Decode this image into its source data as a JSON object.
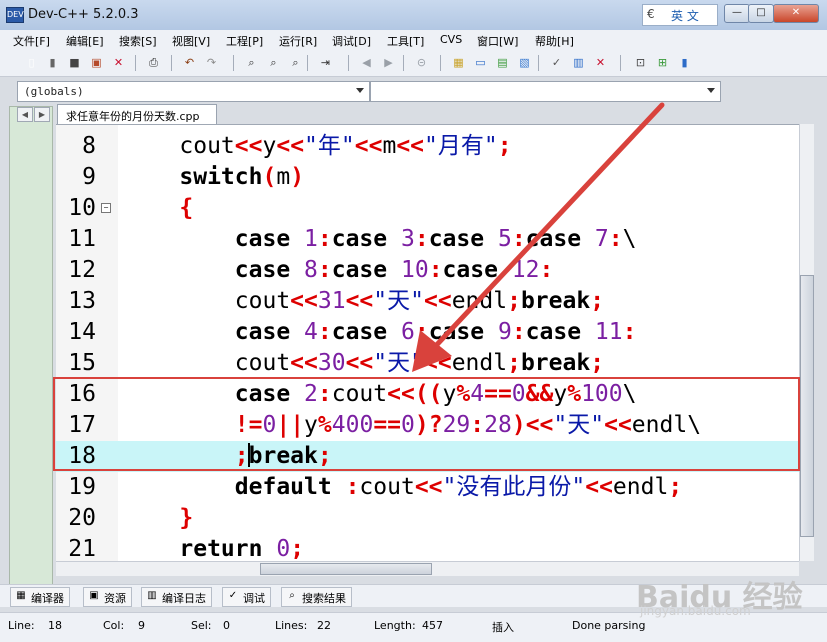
{
  "window": {
    "title": "Dev-C++ 5.2.0.3",
    "app_icon": "DEV"
  },
  "ime": {
    "label": "英 文",
    "logo_glyph": "€",
    "logo_icon": "ime-logo-icon"
  },
  "window_buttons": {
    "minimize": "—",
    "restore": "□",
    "close": "✕"
  },
  "menu": [
    "文件[F]",
    "编辑[E]",
    "搜索[S]",
    "视图[V]",
    "工程[P]",
    "运行[R]",
    "调试[D]",
    "工具[T]",
    "CVS",
    "窗口[W]",
    "帮助[H]"
  ],
  "toolbar_icons": [
    {
      "name": "new-file-icon",
      "glyph": "▯",
      "color": "#ffffff"
    },
    {
      "name": "open-file-icon",
      "glyph": "▮",
      "color": "#666666"
    },
    {
      "name": "save-icon",
      "glyph": "■",
      "color": "#444444"
    },
    {
      "name": "save-all-icon",
      "glyph": "▣",
      "color": "#b54a2a"
    },
    {
      "name": "close-file-icon",
      "glyph": "✕",
      "color": "#c8102e"
    },
    {
      "name": "print-icon",
      "glyph": "⎙",
      "color": "#333333"
    },
    {
      "name": "undo-icon",
      "glyph": "↶",
      "color": "#8a3d12"
    },
    {
      "name": "redo-icon",
      "glyph": "↷",
      "color": "#8a8a8a"
    },
    {
      "name": "find-icon",
      "glyph": "⌕",
      "color": "#333333"
    },
    {
      "name": "find-next-icon",
      "glyph": "⌕",
      "color": "#333333"
    },
    {
      "name": "replace-icon",
      "glyph": "⌕",
      "color": "#333333"
    },
    {
      "name": "goto-line-icon",
      "glyph": "⇥",
      "color": "#333333"
    },
    {
      "name": "bookmark-prev-icon",
      "glyph": "◀",
      "color": "#9aa0a8"
    },
    {
      "name": "bookmark-next-icon",
      "glyph": "▶",
      "color": "#9aa0a8"
    },
    {
      "name": "stop-icon",
      "glyph": "⊝",
      "color": "#9aa0a8"
    },
    {
      "name": "compile-icon",
      "glyph": "▦",
      "color": "#c9a227"
    },
    {
      "name": "run-icon",
      "glyph": "▭",
      "color": "#2d6cc8"
    },
    {
      "name": "compile-run-icon",
      "glyph": "▤",
      "color": "#3a9a3a"
    },
    {
      "name": "rebuild-icon",
      "glyph": "▧",
      "color": "#3b7bd0"
    },
    {
      "name": "check-syntax-icon",
      "glyph": "✓",
      "color": "#555555"
    },
    {
      "name": "profile-icon",
      "glyph": "▥",
      "color": "#2d6cc8"
    },
    {
      "name": "delete-profile-icon",
      "glyph": "✕",
      "color": "#c8102e"
    },
    {
      "name": "new-project-icon",
      "glyph": "⊡",
      "color": "#444444"
    },
    {
      "name": "add-to-project-icon",
      "glyph": "⊞",
      "color": "#3a9a3a"
    },
    {
      "name": "project-options-icon",
      "glyph": "▮",
      "color": "#2d6cc8"
    }
  ],
  "scope_combo": {
    "value": "(globals)"
  },
  "member_combo": {
    "value": ""
  },
  "tab_nav": {
    "left": "◀",
    "right": "▶"
  },
  "file_tab": {
    "label": "求任意年份的月份天数.cpp"
  },
  "code_lines": [
    {
      "num": "8",
      "tokens": [
        [
          "t",
          "    cout"
        ],
        [
          "o",
          "<<"
        ],
        [
          "t",
          "y"
        ],
        [
          "o",
          "<<"
        ],
        [
          "s",
          "\"年\""
        ],
        [
          "o",
          "<<"
        ],
        [
          "t",
          "m"
        ],
        [
          "o",
          "<<"
        ],
        [
          "s",
          "\"月有\""
        ],
        [
          "o",
          ";"
        ]
      ]
    },
    {
      "num": "9",
      "tokens": [
        [
          "k",
          "    switch"
        ],
        [
          "o",
          "("
        ],
        [
          "t",
          "m"
        ],
        [
          "o",
          ")"
        ]
      ]
    },
    {
      "num": "10",
      "fold": "−",
      "tokens": [
        [
          "o",
          "    {"
        ]
      ]
    },
    {
      "num": "11",
      "tokens": [
        [
          "k",
          "        case "
        ],
        [
          "n",
          "1"
        ],
        [
          "o",
          ":"
        ],
        [
          "k",
          "case "
        ],
        [
          "n",
          "3"
        ],
        [
          "o",
          ":"
        ],
        [
          "k",
          "case "
        ],
        [
          "n",
          "5"
        ],
        [
          "o",
          ":"
        ],
        [
          "k",
          "case "
        ],
        [
          "n",
          "7"
        ],
        [
          "o",
          ":"
        ],
        [
          "t",
          "\\"
        ]
      ]
    },
    {
      "num": "12",
      "tokens": [
        [
          "k",
          "        case "
        ],
        [
          "n",
          "8"
        ],
        [
          "o",
          ":"
        ],
        [
          "k",
          "case "
        ],
        [
          "n",
          "10"
        ],
        [
          "o",
          ":"
        ],
        [
          "k",
          "case "
        ],
        [
          "n",
          "12"
        ],
        [
          "o",
          ":"
        ]
      ]
    },
    {
      "num": "13",
      "tokens": [
        [
          "t",
          "        cout"
        ],
        [
          "o",
          "<<"
        ],
        [
          "n",
          "31"
        ],
        [
          "o",
          "<<"
        ],
        [
          "s",
          "\"天\""
        ],
        [
          "o",
          "<<"
        ],
        [
          "t",
          "endl"
        ],
        [
          "o",
          ";"
        ],
        [
          "k",
          "break"
        ],
        [
          "o",
          ";"
        ]
      ]
    },
    {
      "num": "14",
      "tokens": [
        [
          "k",
          "        case "
        ],
        [
          "n",
          "4"
        ],
        [
          "o",
          ":"
        ],
        [
          "k",
          "case "
        ],
        [
          "n",
          "6"
        ],
        [
          "o",
          ":"
        ],
        [
          "k",
          "case "
        ],
        [
          "n",
          "9"
        ],
        [
          "o",
          ":"
        ],
        [
          "k",
          "case "
        ],
        [
          "n",
          "11"
        ],
        [
          "o",
          ":"
        ]
      ]
    },
    {
      "num": "15",
      "tokens": [
        [
          "t",
          "        cout"
        ],
        [
          "o",
          "<<"
        ],
        [
          "n",
          "30"
        ],
        [
          "o",
          "<<"
        ],
        [
          "s",
          "\"天\""
        ],
        [
          "o",
          "<<"
        ],
        [
          "t",
          "endl"
        ],
        [
          "o",
          ";"
        ],
        [
          "k",
          "break"
        ],
        [
          "o",
          ";"
        ]
      ]
    },
    {
      "num": "16",
      "tokens": [
        [
          "k",
          "        case "
        ],
        [
          "n",
          "2"
        ],
        [
          "o",
          ":"
        ],
        [
          "t",
          "cout"
        ],
        [
          "o",
          "<<(("
        ],
        [
          "t",
          "y"
        ],
        [
          "o",
          "%"
        ],
        [
          "n",
          "4"
        ],
        [
          "o",
          "=="
        ],
        [
          "n",
          "0"
        ],
        [
          "o",
          "&&"
        ],
        [
          "t",
          "y"
        ],
        [
          "o",
          "%"
        ],
        [
          "n",
          "100"
        ],
        [
          "t",
          "\\"
        ]
      ]
    },
    {
      "num": "17",
      "tokens": [
        [
          "o",
          "        !="
        ],
        [
          "n",
          "0"
        ],
        [
          "o",
          "||"
        ],
        [
          "t",
          "y"
        ],
        [
          "o",
          "%"
        ],
        [
          "n",
          "400"
        ],
        [
          "o",
          "=="
        ],
        [
          "n",
          "0"
        ],
        [
          "o",
          ")?"
        ],
        [
          "n",
          "29"
        ],
        [
          "o",
          ":"
        ],
        [
          "n",
          "28"
        ],
        [
          "o",
          ")<<"
        ],
        [
          "s",
          "\"天\""
        ],
        [
          "o",
          "<<"
        ],
        [
          "t",
          "endl"
        ],
        [
          "t",
          "\\"
        ]
      ]
    },
    {
      "num": "18",
      "current": true,
      "tokens": [
        [
          "o",
          "        ;"
        ],
        [
          "k",
          "break"
        ],
        [
          "o",
          ";"
        ]
      ]
    },
    {
      "num": "19",
      "tokens": [
        [
          "k",
          "        default "
        ],
        [
          "o",
          ":"
        ],
        [
          "t",
          "cout"
        ],
        [
          "o",
          "<<"
        ],
        [
          "s",
          "\"没有此月份\""
        ],
        [
          "o",
          "<<"
        ],
        [
          "t",
          "endl"
        ],
        [
          "o",
          ";"
        ]
      ]
    },
    {
      "num": "20",
      "tokens": [
        [
          "o",
          "    }"
        ]
      ]
    },
    {
      "num": "21",
      "tokens": [
        [
          "k",
          "    return "
        ],
        [
          "n",
          "0"
        ],
        [
          "o",
          ";"
        ]
      ]
    }
  ],
  "bottom_tabs": [
    {
      "name": "tab-compiler",
      "icon": "compiler-icon",
      "glyph": "▦",
      "label": "编译器"
    },
    {
      "name": "tab-resources",
      "icon": "resources-icon",
      "glyph": "▣",
      "label": "资源"
    },
    {
      "name": "tab-compile-log",
      "icon": "compile-log-icon",
      "glyph": "▥",
      "label": "编译日志"
    },
    {
      "name": "tab-debug",
      "icon": "debug-icon",
      "glyph": "✓",
      "label": "调试"
    },
    {
      "name": "tab-search-results",
      "icon": "search-results-icon",
      "glyph": "⌕",
      "label": "搜索结果"
    }
  ],
  "status": {
    "line_label": "Line:",
    "line": "18",
    "col_label": "Col:",
    "col": "9",
    "sel_label": "Sel:",
    "sel": "0",
    "lines_label": "Lines:",
    "lines": "22",
    "length_label": "Length:",
    "length": "457",
    "mode": "插入",
    "message": "Done parsing"
  },
  "annotation": {
    "box_color": "#d9423c",
    "arrow_color": "#d9423c"
  },
  "watermark": {
    "text": "Baidu 经验",
    "sub": "jingyan.baidu.com"
  }
}
